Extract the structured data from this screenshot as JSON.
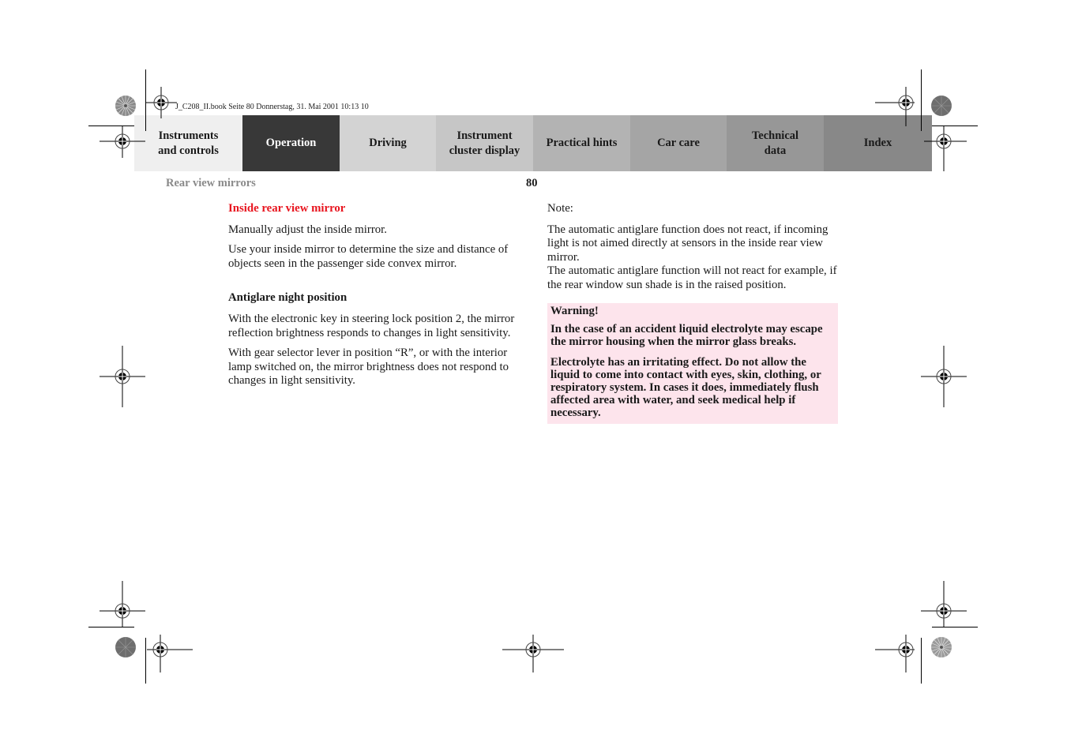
{
  "print_info": "J_C208_II.book  Seite 80  Donnerstag, 31. Mai 2001  10:13 10",
  "tabs": [
    {
      "label_lines": [
        "Instruments",
        "and controls"
      ],
      "bg": "#efefef",
      "fg": "#1a1a1a"
    },
    {
      "label_lines": [
        "Operation"
      ],
      "bg": "#383838",
      "fg": "#ffffff",
      "active": true
    },
    {
      "label_lines": [
        "Driving"
      ],
      "bg": "#d3d3d3",
      "fg": "#1a1a1a"
    },
    {
      "label_lines": [
        "Instrument",
        "cluster display"
      ],
      "bg": "#c6c6c6",
      "fg": "#1a1a1a"
    },
    {
      "label_lines": [
        "Practical hints"
      ],
      "bg": "#b3b3b3",
      "fg": "#1a1a1a"
    },
    {
      "label_lines": [
        "Car care"
      ],
      "bg": "#a5a5a5",
      "fg": "#1a1a1a"
    },
    {
      "label_lines": [
        "Technical",
        "data"
      ],
      "bg": "#979797",
      "fg": "#1a1a1a"
    },
    {
      "label_lines": [
        "Index"
      ],
      "bg": "#888888",
      "fg": "#1a1a1a"
    }
  ],
  "header": {
    "section": "Rear view mirrors",
    "page_number": "80"
  },
  "left_column": {
    "heading": "Inside rear view mirror",
    "para1": "Manually adjust the inside mirror.",
    "para2": "Use your inside mirror to determine the size and distance of objects seen in the passenger side convex mirror.",
    "subheading": "Antiglare night position",
    "para3": "With the electronic key in steering lock position 2, the mirror reflection brightness responds to changes in light sensitivity.",
    "para4": "With gear selector lever in position “R”, or with the interior lamp switched on, the mirror brightness does not respond to changes in light sensitivity."
  },
  "right_column": {
    "note_label": "Note:",
    "note_text1": "The automatic antiglare function does not react, if incoming light is not aimed directly at sensors in the inside rear view mirror.",
    "note_text2": "The automatic antiglare function will not react for example, if the rear window sun shade is in the raised position.",
    "warning": {
      "title": "Warning!",
      "para1": "In the case of an accident liquid electrolyte may escape the mirror housing when the mirror glass breaks.",
      "para2": "Electrolyte has an irritating effect. Do not allow the liquid to come into contact with eyes, skin, clothing, or respiratory system. In cases it does, immediately flush affected area with water, and seek medical help if necessary.",
      "bg": "#fde4ec"
    }
  },
  "colors": {
    "heading_red": "#e8141e",
    "section_gray": "#8a8a8a"
  }
}
